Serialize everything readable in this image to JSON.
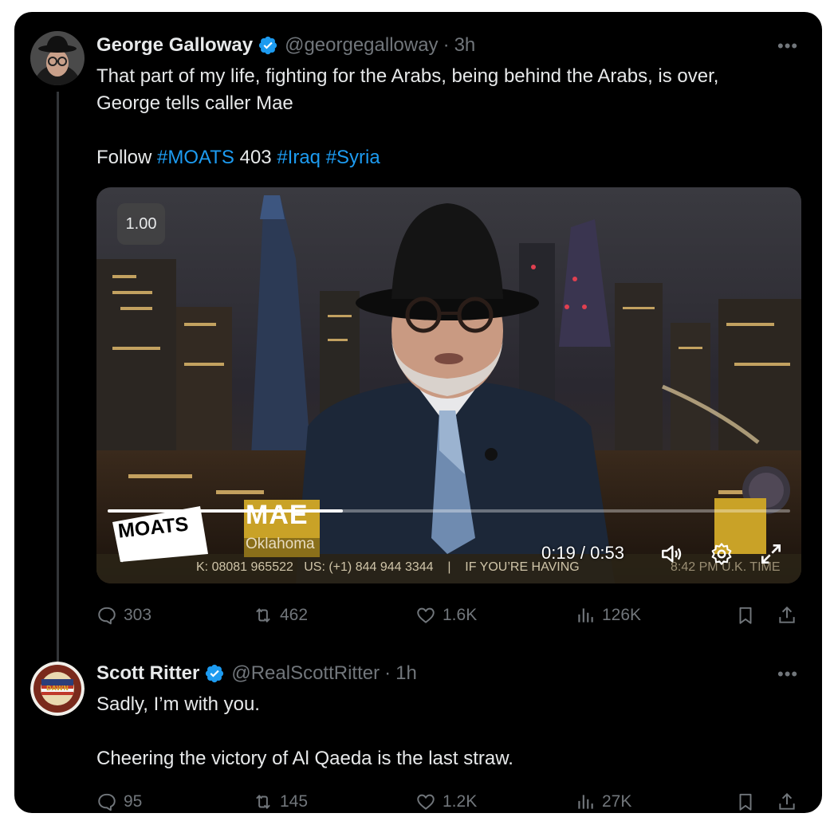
{
  "tweets": [
    {
      "name": "George Galloway",
      "handle": "@georgegalloway",
      "separator": "·",
      "time": "3h",
      "text_line1": "That part of my life, fighting for the Arabs, being behind the Arabs, is over,",
      "text_line2": "George tells caller Mae",
      "follow_prefix": "Follow ",
      "hashtag_moats": "#MOATS",
      "episode_number": " 403 ",
      "hashtag_iraq": "#Iraq",
      "hashtag_syria": "#Syria",
      "replies": "303",
      "reposts": "462",
      "likes": "1.6K",
      "views": "126K"
    },
    {
      "name": "Scott Ritter",
      "handle": "@RealScottRitter",
      "separator": "·",
      "time": "1h",
      "text_line1": "Sadly, I’m with you.",
      "text_line2": "Cheering the victory of Al Qaeda is the last straw.",
      "replies": "95",
      "reposts": "145",
      "likes": "1.2K",
      "views": "27K"
    }
  ],
  "video": {
    "playback_speed": "1.00",
    "time_display": "0:19 / 0:53",
    "progress_fraction": 0.345,
    "show_logo": "MOATS",
    "caller_name": "MAE",
    "caller_location": "Oklahoma",
    "ticker_text": "K: 08081 965522   US: (+1) 844 944 3344    |    IF YOU’RE HAVING",
    "ticker_clock": "8:42 PM U.K. TIME"
  },
  "avatar_badge_text": "DAWN",
  "colors": {
    "background": "#000000",
    "text": "#e7e9ea",
    "muted": "#71767b",
    "accent": "#1d9bf0",
    "lower_third_gold": "#c9a227"
  },
  "icons": [
    "more-icon",
    "verified-icon",
    "reply-icon",
    "repost-icon",
    "like-icon",
    "views-icon",
    "bookmark-icon",
    "share-icon",
    "play-icon",
    "volume-icon",
    "settings-icon",
    "fullscreen-icon"
  ]
}
